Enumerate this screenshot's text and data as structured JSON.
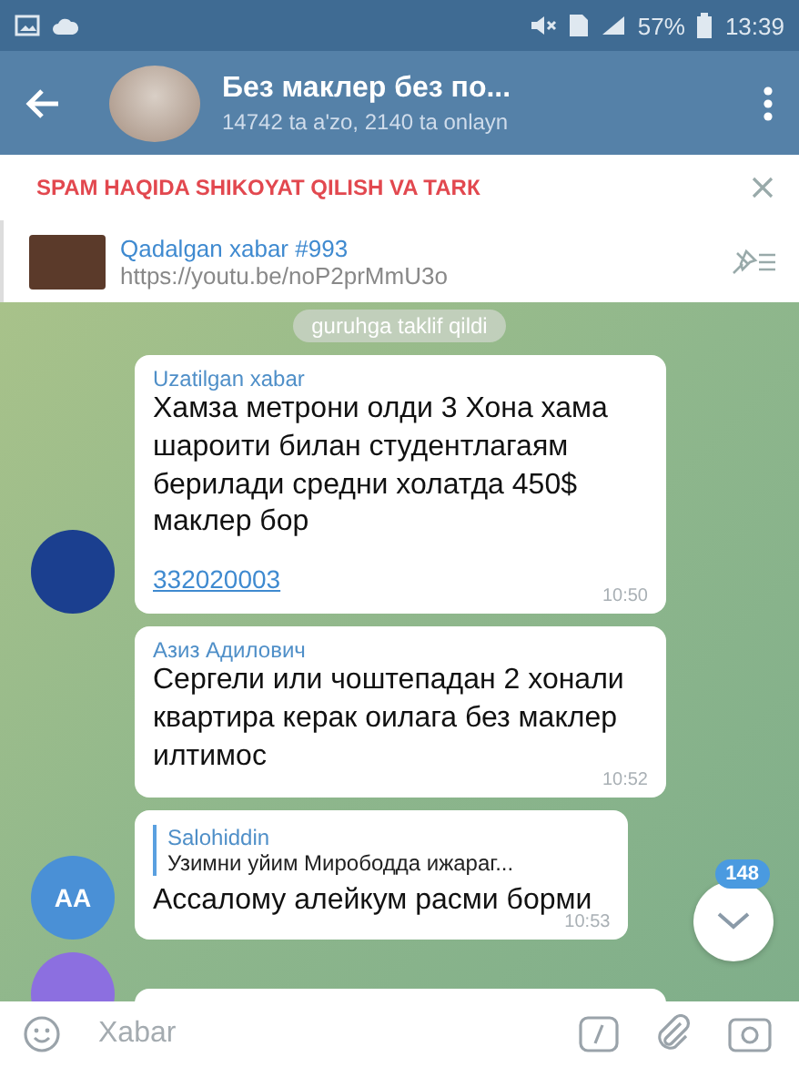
{
  "status_bar": {
    "battery": "57%",
    "time": "13:39"
  },
  "header": {
    "title": "Без маклер без по...",
    "subtitle": "14742 ta a'zo, 2140 ta onlayn"
  },
  "spam_banner": {
    "text": "SPAM HAQIDA SHIKOYAT QILISH VA TARК"
  },
  "pinned": {
    "title": "Qadalgan xabar #993",
    "link": "https://youtu.be/noP2prMmU3o"
  },
  "service_message": {
    "text": "guruhga taklif qildi"
  },
  "messages": [
    {
      "forwarded_label": "Uzatilgan xabar",
      "text": "Хамза метрони олди 3 Хона хама шароити билан студентлагаям берилади средни холатда 450$ маклер бор",
      "link": "332020003",
      "time": "10:50",
      "avatar": {
        "color": "#1b3f8f"
      }
    },
    {
      "sender": "Азиз Адилович",
      "text": "Сергели или чоштепадан 2 хонали квартира керак оилага без маклер илтимос",
      "time": "10:52"
    },
    {
      "reply": {
        "name": "Salohiddin",
        "text": "Узимни уйим Мирободда ижараг..."
      },
      "text": "Ассалому алейкум расми борми",
      "time": "10:53",
      "avatar": {
        "initials": "AA",
        "color": "#4a90d6"
      }
    },
    {
      "avatar": {
        "color": "#8c6fe0"
      }
    }
  ],
  "scroll_button": {
    "badge": "148"
  },
  "composer": {
    "placeholder": "Xabar"
  }
}
